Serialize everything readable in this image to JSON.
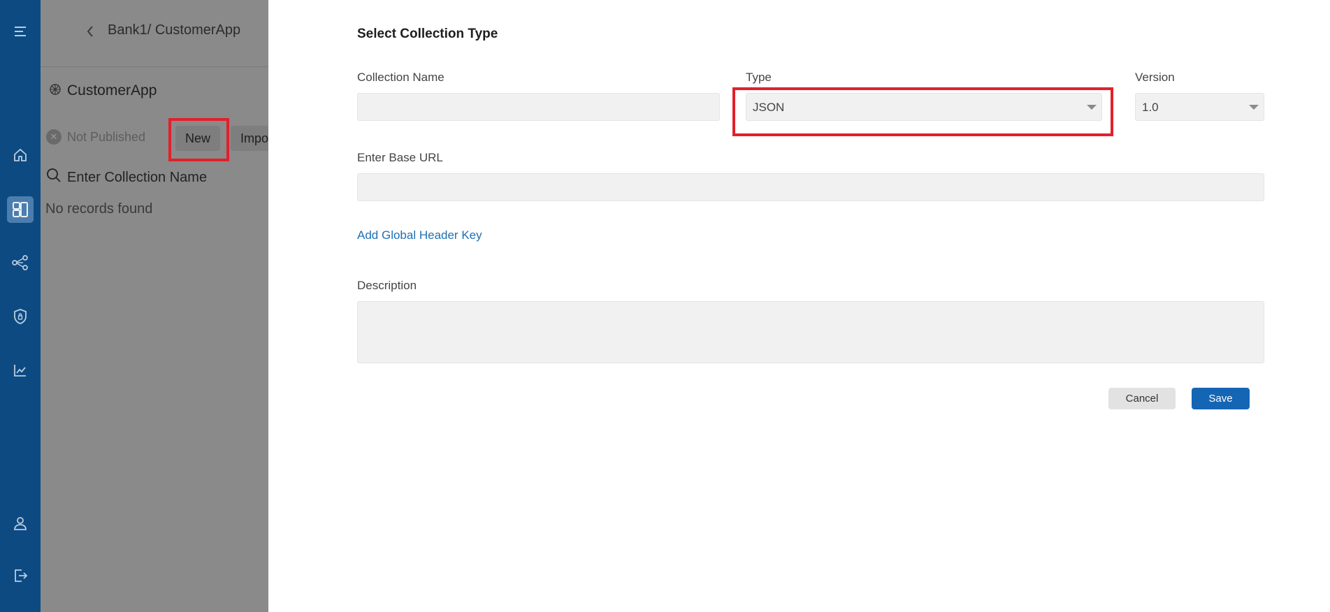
{
  "background": {
    "breadcrumb": "Bank1/ CustomerApp",
    "app_name": "CustomerApp",
    "status": "Not Published",
    "new_button": "New",
    "import_button": "Impo",
    "search_placeholder": "Enter Collection Name",
    "empty_message": "No records found"
  },
  "rail": {
    "icons": [
      "menu-icon",
      "home-icon",
      "dashboard-icon",
      "flow-icon",
      "security-shield-icon",
      "analytics-chart-icon",
      "user-icon",
      "logout-icon"
    ]
  },
  "modal": {
    "title": "Select Collection Type",
    "collection_name_label": "Collection Name",
    "collection_name_value": "",
    "type_label": "Type",
    "type_value": "JSON",
    "version_label": "Version",
    "version_value": "1.0",
    "base_url_label": "Enter Base URL",
    "base_url_value": "",
    "add_header_link": "Add Global Header Key",
    "description_label": "Description",
    "description_value": "",
    "cancel_label": "Cancel",
    "save_label": "Save"
  },
  "colors": {
    "rail": "#0d4a82",
    "overlay": "#8a8a8a",
    "highlight": "#e2202b",
    "primary": "#1565b5",
    "link": "#1f6fb5"
  }
}
